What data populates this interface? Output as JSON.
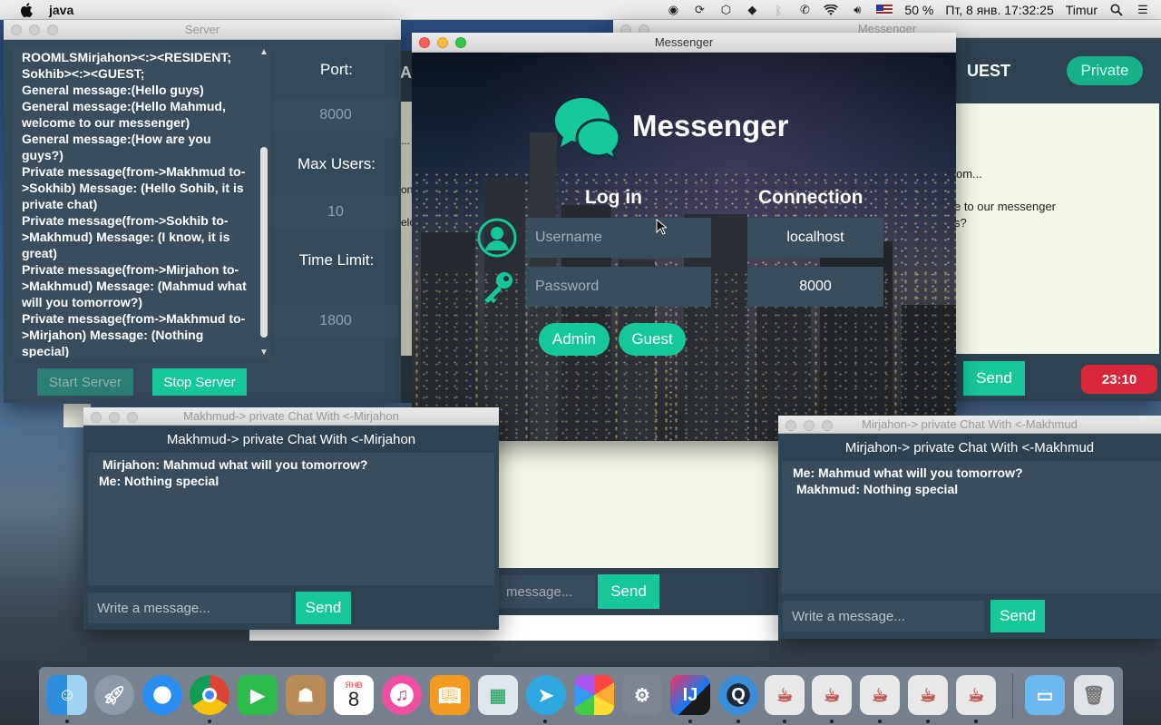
{
  "menubar": {
    "app_name": "java",
    "battery": "50 %",
    "datetime": "Пт, 8 янв.  17:32:25",
    "user": "Timur"
  },
  "server": {
    "title": "Server",
    "log_lines": [
      "ROOMLSMirjahon><:><RESIDENT;",
      "Sokhib><:><GUEST;",
      "General message:(Hello guys)",
      "General message:(Hello Mahmud, welcome to our messenger)",
      "General message:(How are you guys?)",
      "Private message(from->Makhmud to->Sokhib) Message: (Hello Sohib, it is private chat)",
      "Private message(from->Sokhib to->Makhmud) Message: (I know, it is great)",
      "Private message(from->Mirjahon to->Makhmud) Message: (Mahmud what will you tomorrow?)",
      "Private message(from->Makhmud to->Mirjahon) Message: (Nothing special)"
    ],
    "port_label": "Port:",
    "port_value": "8000",
    "max_users_label": "Max Users:",
    "max_users_value": "10",
    "time_limit_label": "Time Limit:",
    "time_limit_value": "1800",
    "start_button": "Start Server",
    "stop_button": "Stop Server"
  },
  "login": {
    "title": "Messenger",
    "brand": "Messenger",
    "login_heading": "Log in",
    "connection_heading": "Connection",
    "username_placeholder": "Username",
    "password_placeholder": "Password",
    "host_value": "localhost",
    "port_value": "8000",
    "admin_button": "Admin",
    "guest_button": "Guest"
  },
  "bg_messenger": {
    "title": "Messenger",
    "header_fragment": "UEST",
    "header_fragment_left": "A",
    "private_button": "Private",
    "line1": "om...",
    "line2": "e to our messenger",
    "line3": "s?",
    "send_button": "Send",
    "timer": "23:10",
    "left_fragments": [
      "...",
      "on",
      "elc"
    ]
  },
  "bg_chat": {
    "placeholder": "message...",
    "send_button": "Send"
  },
  "chat_makhmud": {
    "title": "Makhmud-> private Chat With <-Mirjahon",
    "header": "Makhmud-> private Chat With <-Mirjahon",
    "messages": [
      "Mirjahon: Mahmud what will you tomorrow?",
      "Me: Nothing special"
    ],
    "placeholder": "Write a message...",
    "send_button": "Send"
  },
  "chat_mirjahon": {
    "title": "Mirjahon-> private Chat With <-Makhmud",
    "header": "Mirjahon-> private Chat With <-Makhmud",
    "messages": [
      "Me: Mahmud what will you tomorrow?",
      "Makhmud: Nothing special"
    ],
    "placeholder": "Write a message...",
    "send_button": "Send"
  },
  "dock": {
    "calendar_month": "ЯНВ",
    "calendar_day": "8",
    "items": [
      "finder-icon",
      "launchpad-icon",
      "safari-icon",
      "chrome-icon",
      "facetime-icon",
      "contacts-icon",
      "calendar-icon",
      "itunes-icon",
      "ibooks-icon",
      "preview-icon",
      "telegram-icon",
      "photos-icon",
      "system-preferences-icon",
      "intellij-icon",
      "quicktime-icon",
      "java-app-icon",
      "java-app-icon",
      "java-app-icon",
      "java-app-icon",
      "java-app-icon",
      "downloads-folder-icon",
      "trash-icon"
    ]
  }
}
